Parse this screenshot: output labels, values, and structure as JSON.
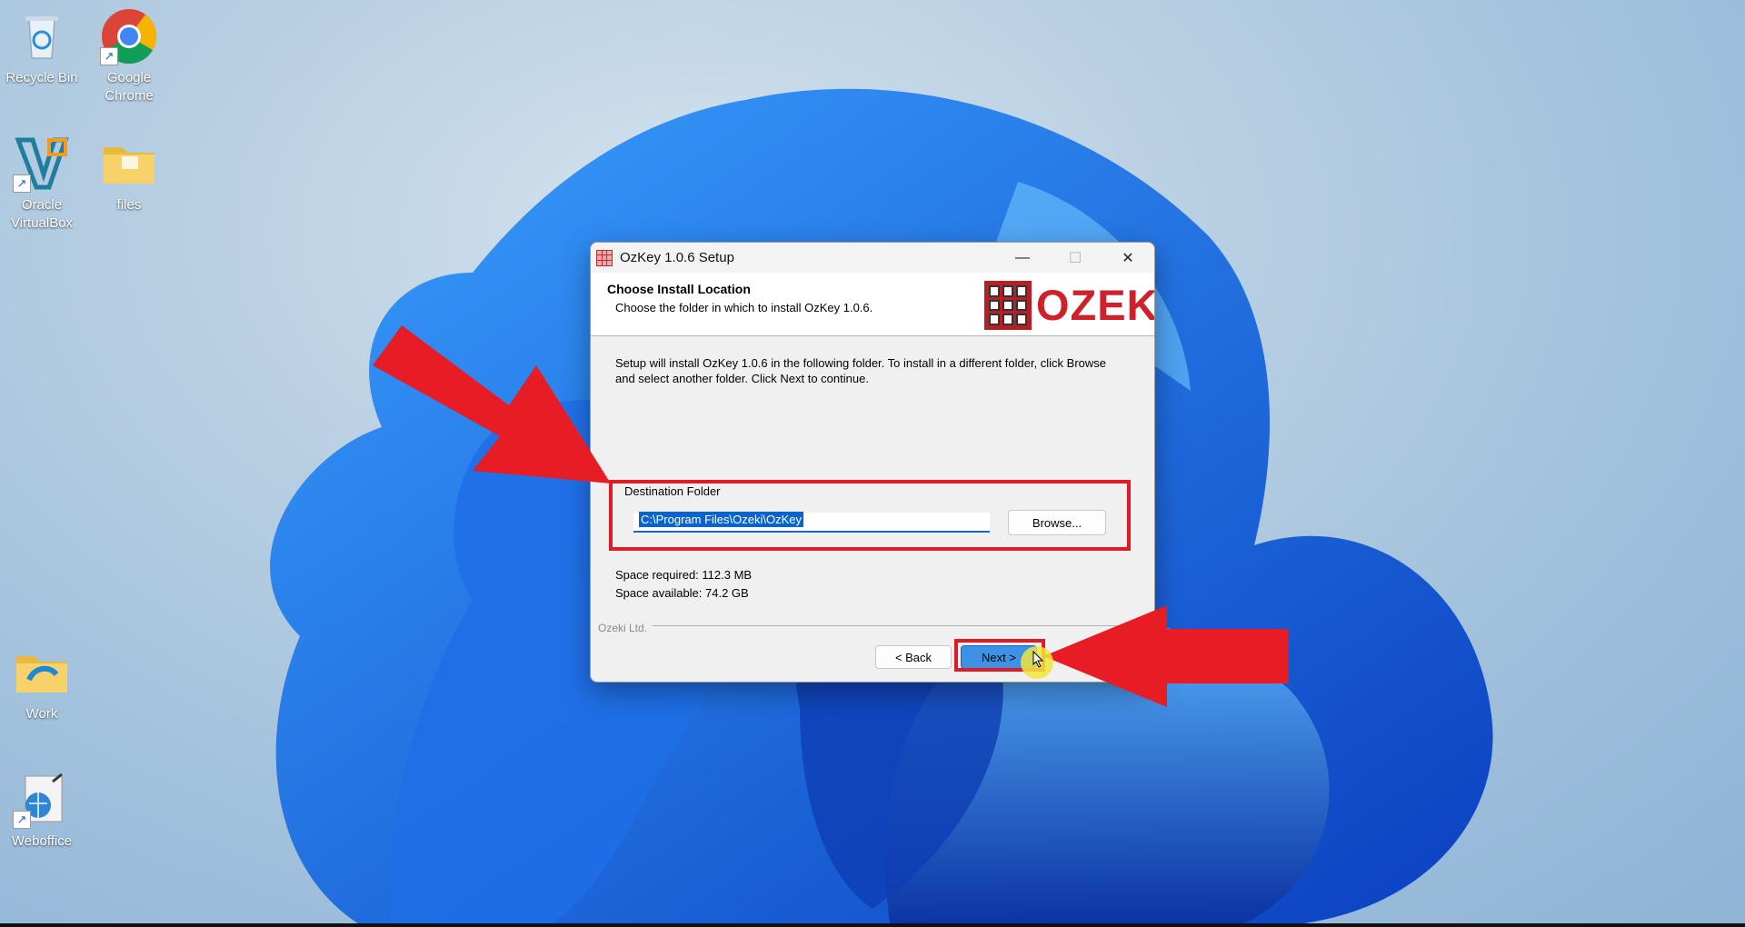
{
  "desktop": {
    "icons": [
      {
        "label_line1": "Recycle Bin",
        "label_line2": "",
        "icon": "recycle-bin-icon"
      },
      {
        "label_line1": "Google",
        "label_line2": "Chrome",
        "icon": "chrome-icon"
      },
      {
        "label_line1": "Oracle",
        "label_line2": "VirtualBox",
        "icon": "virtualbox-icon"
      },
      {
        "label_line1": "files",
        "label_line2": "",
        "icon": "folder-icon"
      },
      {
        "label_line1": "Work",
        "label_line2": "",
        "icon": "folder-icon"
      },
      {
        "label_line1": "Weboffice",
        "label_line2": "",
        "icon": "weboffice-icon"
      }
    ]
  },
  "dialog": {
    "title": "OzKey 1.0.6 Setup",
    "minimize": "—",
    "maximize": "☐",
    "close": "✕",
    "header_title": "Choose Install Location",
    "header_subtitle": "Choose the folder in which to install OzKey 1.0.6.",
    "logo_text": "OZEKI",
    "intro_text": "Setup will install OzKey 1.0.6 in the following folder. To install in a different folder, click Browse and select another folder. Click Next to continue.",
    "destination_legend": "Destination Folder",
    "destination_value": "C:\\Program Files\\Ozeki\\OzKey",
    "browse_label": "Browse...",
    "space_required": "Space required: 112.3 MB",
    "space_available": "Space available: 74.2 GB",
    "brand": "Ozeki Ltd.",
    "back_label": "< Back",
    "next_label": "Next >"
  },
  "colors": {
    "highlight_red": "#e01b24",
    "accent_blue": "#1a66c8"
  }
}
